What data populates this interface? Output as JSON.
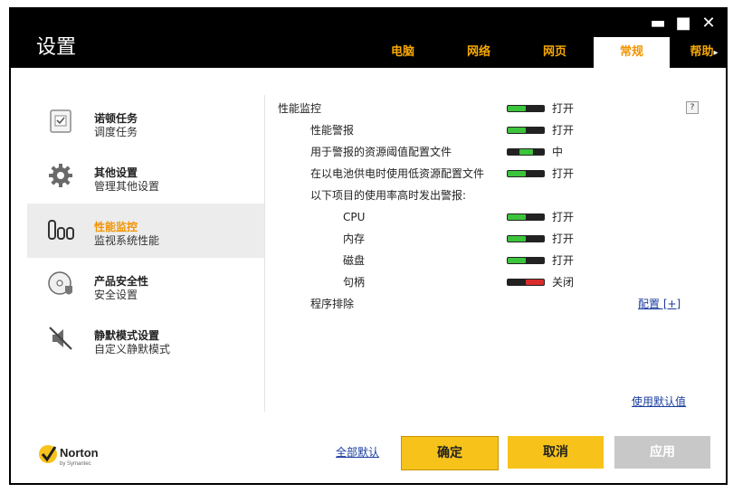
{
  "window": {
    "title": "设置",
    "minimize": "▬",
    "maximize": "■",
    "close": "✕"
  },
  "tabs": [
    {
      "label": "电脑"
    },
    {
      "label": "网络"
    },
    {
      "label": "网页"
    },
    {
      "label": "常规",
      "active": true
    },
    {
      "label": "帮助",
      "arrow": "▸"
    }
  ],
  "sidebar": {
    "items": [
      {
        "title": "诺顿任务",
        "subtitle": "调度任务",
        "icon": "task-icon"
      },
      {
        "title": "其他设置",
        "subtitle": "管理其他设置",
        "icon": "gear-icon"
      },
      {
        "title": "性能监控",
        "subtitle": "监视系统性能",
        "icon": "performance-icon",
        "active": true
      },
      {
        "title": "产品安全性",
        "subtitle": "安全设置",
        "icon": "disc-shield-icon"
      },
      {
        "title": "静默模式设置",
        "subtitle": "自定义静默模式",
        "icon": "mute-icon"
      }
    ]
  },
  "panel": {
    "help": "?",
    "rows": [
      {
        "label": "性能监控",
        "state": "打开",
        "toggle": "on"
      },
      {
        "label": "性能警报",
        "state": "打开",
        "toggle": "on"
      },
      {
        "label": "用于警报的资源阈值配置文件",
        "state": "中",
        "toggle": "mid"
      },
      {
        "label": "在以电池供电时使用低资源配置文件",
        "state": "打开",
        "toggle": "on"
      },
      {
        "label": "以下项目的使用率高时发出警报:",
        "state": "",
        "toggle": "none"
      },
      {
        "label": "CPU",
        "state": "打开",
        "toggle": "on"
      },
      {
        "label": "内存",
        "state": "打开",
        "toggle": "on"
      },
      {
        "label": "磁盘",
        "state": "打开",
        "toggle": "on"
      },
      {
        "label": "句柄",
        "state": "关闭",
        "toggle": "off"
      },
      {
        "label": "程序排除",
        "state": "",
        "toggle": "none"
      }
    ],
    "configure_link": "配置 [+]",
    "use_defaults_link": "使用默认值"
  },
  "footer": {
    "all_defaults": "全部默认",
    "ok": "确定",
    "cancel": "取消",
    "apply": "应用"
  },
  "brand": {
    "name": "Norton",
    "by": "by Symantec"
  },
  "colors": {
    "accent": "#f29400",
    "toggle_on": "#3cc43c",
    "toggle_off": "#d92c2c",
    "button": "#f7c31a"
  }
}
